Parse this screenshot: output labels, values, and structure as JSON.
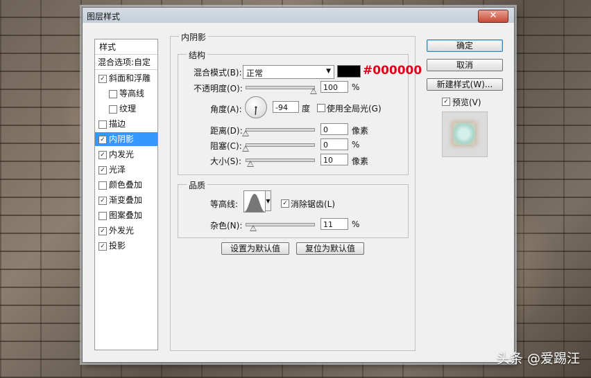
{
  "window": {
    "title": "图层样式",
    "close_symbol": "✕"
  },
  "style_list": {
    "header": "样式",
    "blend_options": "混合选项:自定",
    "items": [
      {
        "label": "斜面和浮雕",
        "checked": true,
        "indent": false,
        "selected": false
      },
      {
        "label": "等高线",
        "checked": false,
        "indent": true,
        "selected": false
      },
      {
        "label": "纹理",
        "checked": false,
        "indent": true,
        "selected": false
      },
      {
        "label": "描边",
        "checked": false,
        "indent": false,
        "selected": false
      },
      {
        "label": "内阴影",
        "checked": true,
        "indent": false,
        "selected": true
      },
      {
        "label": "内发光",
        "checked": true,
        "indent": false,
        "selected": false
      },
      {
        "label": "光泽",
        "checked": true,
        "indent": false,
        "selected": false
      },
      {
        "label": "颜色叠加",
        "checked": false,
        "indent": false,
        "selected": false
      },
      {
        "label": "渐变叠加",
        "checked": true,
        "indent": false,
        "selected": false
      },
      {
        "label": "图案叠加",
        "checked": false,
        "indent": false,
        "selected": false
      },
      {
        "label": "外发光",
        "checked": true,
        "indent": false,
        "selected": false
      },
      {
        "label": "投影",
        "checked": true,
        "indent": false,
        "selected": false
      }
    ],
    "check_mark": "✓"
  },
  "panel": {
    "title": "内阴影",
    "structure": {
      "title": "结构",
      "blend_mode_label": "混合模式(B):",
      "blend_mode_value": "正常",
      "dropdown_arrow": "▼",
      "color_hex": "#000000",
      "opacity_label": "不透明度(O):",
      "opacity_value": "100",
      "opacity_unit": "%",
      "opacity_fraction": 1.0,
      "angle_label": "角度(A):",
      "angle_value": "-94",
      "angle_deg": -94,
      "angle_unit": "度",
      "global_light_label": "使用全局光(G)",
      "global_light_checked": false,
      "distance_label": "距离(D):",
      "distance_value": "0",
      "distance_unit": "像素",
      "distance_fraction": 0.0,
      "choke_label": "阻塞(C):",
      "choke_value": "0",
      "choke_unit": "%",
      "choke_fraction": 0.0,
      "size_label": "大小(S):",
      "size_value": "10",
      "size_unit": "像素",
      "size_fraction": 0.07
    },
    "quality": {
      "title": "品质",
      "contour_label": "等高线:",
      "antialias_label": "消除锯齿(L)",
      "antialias_checked": true,
      "noise_label": "杂色(N):",
      "noise_value": "11",
      "noise_unit": "%",
      "noise_fraction": 0.11
    },
    "make_default": "设置为默认值",
    "reset_default": "复位为默认值"
  },
  "buttons": {
    "ok": "确定",
    "cancel": "取消",
    "new_style": "新建样式(W)...",
    "preview_label": "预览(V)",
    "preview_checked": true
  },
  "watermark": "头条 @爱踢汪"
}
